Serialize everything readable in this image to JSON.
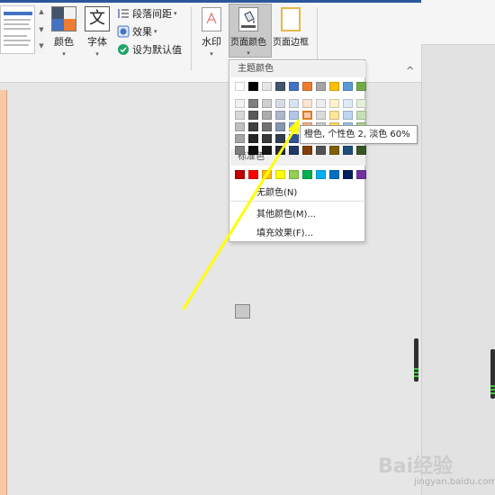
{
  "ribbon": {
    "colors_label": "颜色",
    "fonts_label": "字体",
    "font_glyph": "文",
    "paragraph_spacing": "段落间距",
    "effects": "效果",
    "set_default": "设为默认值",
    "watermark_label": "水印",
    "page_color_label": "页面颜色",
    "page_border_label": "页面边框",
    "dropdown_chevron": "▾",
    "collapse_glyph": "^"
  },
  "menu": {
    "theme_colors_header": "主题颜色",
    "standard_colors_header": "标准色",
    "no_color": "无颜色(N)",
    "more_colors": "其他颜色(M)...",
    "fill_effects": "填充效果(F)...",
    "theme_colors": [
      [
        "#ffffff",
        "#000000",
        "#e7e6e6",
        "#44546a",
        "#4472c4",
        "#ed7d31",
        "#a5a5a5",
        "#ffc000",
        "#5b9bd5",
        "#70ad47"
      ],
      [
        "#f2f2f2",
        "#7f7f7f",
        "#d0cece",
        "#d6dce4",
        "#d9e2f3",
        "#fbe4d5",
        "#ededed",
        "#fff2cc",
        "#deeaf6",
        "#e2efd9"
      ],
      [
        "#d8d8d8",
        "#595959",
        "#aeabab",
        "#adb9ca",
        "#b4c6e7",
        "#f7caac",
        "#dbdbdb",
        "#fee599",
        "#bdd6ee",
        "#c5e0b3"
      ],
      [
        "#bfbfbf",
        "#3f3f3f",
        "#757070",
        "#8496b0",
        "#8eaadb",
        "#f4b183",
        "#c9c9c9",
        "#ffd966",
        "#9cc2e5",
        "#a8d08d"
      ],
      [
        "#a5a5a5",
        "#262626",
        "#3a3838",
        "#323e4f",
        "#2f5496",
        "#c45911",
        "#7b7b7b",
        "#bf8f00",
        "#2e75b5",
        "#538135"
      ],
      [
        "#7f7f7f",
        "#0c0c0c",
        "#171616",
        "#222a35",
        "#1f3864",
        "#833c0b",
        "#525252",
        "#7f6000",
        "#1f4e79",
        "#375623"
      ]
    ],
    "standard_colors": [
      "#c00000",
      "#ff0000",
      "#ffc000",
      "#ffff00",
      "#92d050",
      "#00b050",
      "#00b0f0",
      "#0070c0",
      "#002060",
      "#7030a0"
    ]
  },
  "tooltip": {
    "text": "橙色, 个性色 2, 淡色 60%"
  },
  "watermark": {
    "logo": "Bai经验",
    "sub": "jingyan.baidu.com"
  },
  "colors": {
    "annotation_arrow": "#ffff00",
    "doc_page": "#f8c9a5",
    "ribbon_accent": "#2b579a"
  }
}
